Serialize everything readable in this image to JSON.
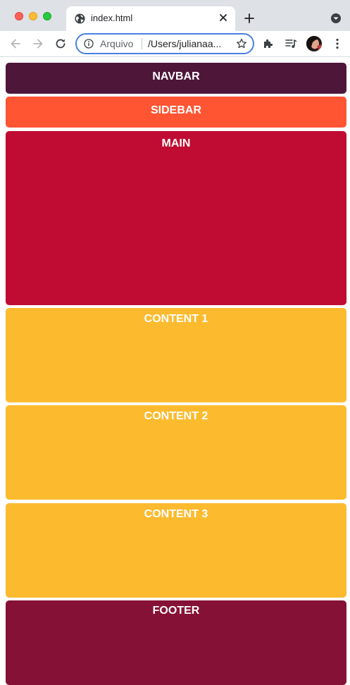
{
  "browser": {
    "tab": {
      "title": "index.html"
    },
    "omnibox": {
      "security_label": "Arquivo",
      "url": "/Users/julianaa..."
    }
  },
  "page": {
    "navbar": {
      "label": "NAVBAR",
      "color": "#4e173a"
    },
    "sidebar": {
      "label": "SIDEBAR",
      "color": "#ff5533"
    },
    "main": {
      "label": "MAIN",
      "color": "#c00b32"
    },
    "contents": [
      {
        "label": "CONTENT 1",
        "color": "#fcbb2f"
      },
      {
        "label": "CONTENT 2",
        "color": "#fcbb2f"
      },
      {
        "label": "CONTENT 3",
        "color": "#fcbb2f"
      }
    ],
    "footer": {
      "label": "FOOTER",
      "color": "#861136"
    }
  }
}
